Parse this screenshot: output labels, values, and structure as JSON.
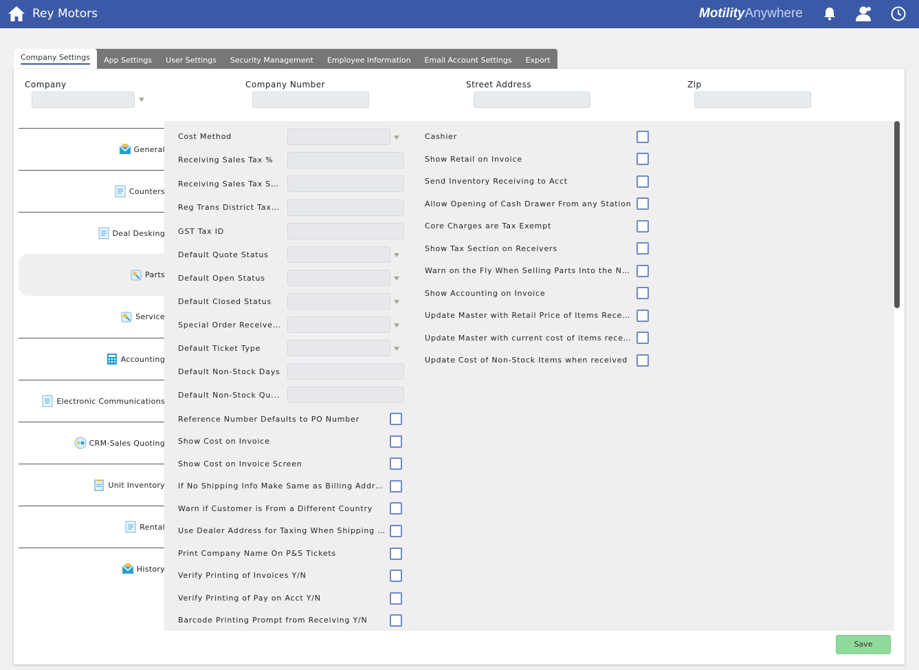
{
  "header": {
    "app_title": "Rey Motors",
    "brand_bold": "Motility",
    "brand_light": "Anywhere",
    "icons": [
      "home-icon",
      "bell-icon",
      "user-icon",
      "clock-icon"
    ],
    "bar_color": "#3a5aa8"
  },
  "tabs": [
    {
      "label": "Company Settings",
      "active": true
    },
    {
      "label": "App Settings"
    },
    {
      "label": "User Settings"
    },
    {
      "label": "Security Management"
    },
    {
      "label": "Employee Information"
    },
    {
      "label": "Email Account Settings"
    },
    {
      "label": "Export"
    }
  ],
  "company_fields": {
    "company_label": "Company",
    "company_value": "",
    "company_number_label": "Company Number",
    "company_number_value": "",
    "street_address_label": "Street Address",
    "street_address_value": "",
    "zip_label": "Zip",
    "zip_value": ""
  },
  "sidebar": {
    "items": [
      {
        "label": "General",
        "icon": "envelope-icon"
      },
      {
        "label": "Counters",
        "icon": "document-icon"
      },
      {
        "label": "Deal Desking",
        "icon": "document-icon"
      },
      {
        "label": "Parts",
        "icon": "parts-icon",
        "active": true
      },
      {
        "label": "Service",
        "icon": "service-icon"
      },
      {
        "label": "Accounting",
        "icon": "calculator-icon"
      },
      {
        "label": "Electronic Communications",
        "icon": "document-icon"
      },
      {
        "label": "CRM-Sales Quoting",
        "icon": "crm-icon"
      },
      {
        "label": "Unit Inventory",
        "icon": "clipboard-icon"
      },
      {
        "label": "Rental",
        "icon": "document-icon"
      },
      {
        "label": "History",
        "icon": "envelope-icon"
      }
    ]
  },
  "parts_left": {
    "inputs": [
      {
        "label": "Cost Method",
        "type": "select"
      },
      {
        "label": "Receiving Sales Tax %",
        "type": "text"
      },
      {
        "label": "Receiving Sales Tax Sec...",
        "type": "text"
      },
      {
        "label": "Reg Trans District Tax %",
        "type": "text"
      },
      {
        "label": "GST Tax ID",
        "type": "text"
      },
      {
        "label": "Default Quote Status",
        "type": "select"
      },
      {
        "label": "Default Open Status",
        "type": "select"
      },
      {
        "label": "Default Closed Status",
        "type": "select"
      },
      {
        "label": "Special Order Received...",
        "type": "select"
      },
      {
        "label": "Default Ticket Type",
        "type": "select"
      },
      {
        "label": "Default Non-Stock Days",
        "type": "text"
      },
      {
        "label": "Default Non-Stock Qu...",
        "type": "text"
      }
    ],
    "checkboxes": [
      {
        "label": "Reference Number Defaults to PO Number",
        "checked": false
      },
      {
        "label": "Show Cost on Invoice",
        "checked": false
      },
      {
        "label": "Show Cost on Invoice Screen",
        "checked": false
      },
      {
        "label": "If No Shipping Info Make Same as Billing Address",
        "checked": false
      },
      {
        "label": "Warn if Customer is From a Different Country",
        "checked": false
      },
      {
        "label": "Use Dealer Address for Taxing When Shipping in St...",
        "checked": false
      },
      {
        "label": "Print Company Name On P&S Tickets",
        "checked": false
      },
      {
        "label": "Verify Printing of Invoices Y/N",
        "checked": false
      },
      {
        "label": "Verify Printing of Pay on Acct Y/N",
        "checked": false
      },
      {
        "label": "Barcode Printing Prompt from Receiving Y/N",
        "checked": false
      }
    ]
  },
  "parts_right": {
    "checkboxes": [
      {
        "label": "Cashier",
        "checked": false
      },
      {
        "label": "Show Retail on Invoice",
        "checked": false
      },
      {
        "label": "Send Inventory Receiving to Acct",
        "checked": false
      },
      {
        "label": "Allow Opening of Cash Drawer From any Station",
        "checked": false
      },
      {
        "label": "Core Charges are Tax Exempt",
        "checked": false
      },
      {
        "label": "Show Tax Section on Receivers",
        "checked": false
      },
      {
        "label": "Warn on the Fly When Selling Parts Into the Nega...",
        "checked": false
      },
      {
        "label": "Show Accounting on Invoice",
        "checked": false
      },
      {
        "label": "Update Master with Retail Price of Items Received",
        "checked": false
      },
      {
        "label": "Update Master with current cost of items received",
        "checked": false
      },
      {
        "label": "Update Cost of Non-Stock Items when received",
        "checked": false
      }
    ]
  },
  "footer": {
    "save_label": "Save",
    "save_color": "#8fd99b"
  }
}
